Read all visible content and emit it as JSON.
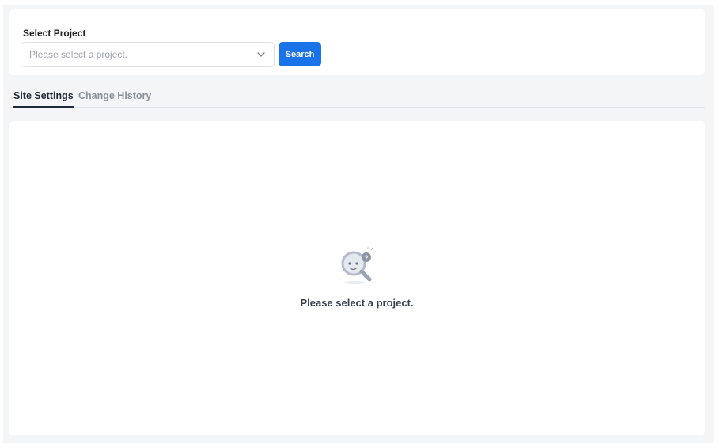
{
  "project_selector": {
    "label": "Select Project",
    "placeholder": "Please select a project.",
    "search_button_label": "Search"
  },
  "tabs": [
    {
      "label": "Site Settings",
      "active": true
    },
    {
      "label": "Change History",
      "active": false
    }
  ],
  "empty_state": {
    "message": "Please select a project.",
    "icon": "magnifier-question-icon"
  },
  "colors": {
    "accent": "#1a73e8",
    "background": "#f4f5f7",
    "card": "#ffffff"
  }
}
